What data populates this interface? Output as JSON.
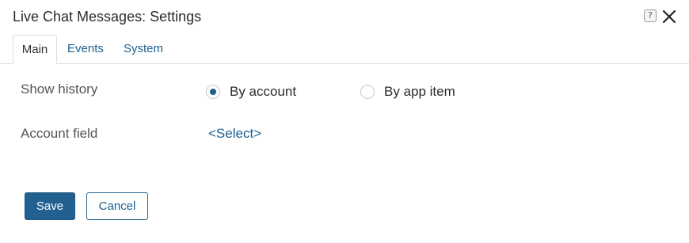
{
  "dialog": {
    "title": "Live Chat Messages: Settings",
    "help_icon": "?"
  },
  "tabs": [
    {
      "label": "Main",
      "active": true
    },
    {
      "label": "Events",
      "active": false
    },
    {
      "label": "System",
      "active": false
    }
  ],
  "form": {
    "show_history": {
      "label": "Show history",
      "options": [
        {
          "label": "By account",
          "checked": true
        },
        {
          "label": "By app item",
          "checked": false
        }
      ]
    },
    "account_field": {
      "label": "Account field",
      "value": "<Select>"
    }
  },
  "buttons": {
    "save_label": "Save",
    "cancel_label": "Cancel"
  },
  "colors": {
    "accent": "#1d5e8e",
    "primary_button": "#22618f"
  }
}
